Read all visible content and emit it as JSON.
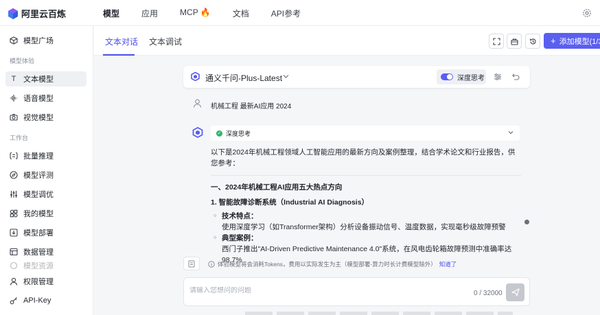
{
  "brand": {
    "name": "阿里云百炼",
    "accent": "#5a5ff0"
  },
  "topnav": {
    "items": [
      "模型",
      "应用",
      "MCP 🔥",
      "文档",
      "API参考"
    ],
    "active": "模型"
  },
  "sidebar": {
    "top": {
      "label": "模型广场",
      "icon": "cube-icon"
    },
    "sections": [
      {
        "title": "模型体验",
        "items": [
          {
            "label": "文本模型",
            "icon": "text-icon",
            "active": true
          },
          {
            "label": "语音模型",
            "icon": "waveform-icon"
          },
          {
            "label": "视觉模型",
            "icon": "camera-icon"
          }
        ]
      },
      {
        "title": "工作台",
        "items": [
          {
            "label": "批量推理",
            "icon": "list-icon"
          },
          {
            "label": "模型评测",
            "icon": "compass-icon"
          },
          {
            "label": "模型调优",
            "icon": "sliders-icon"
          },
          {
            "label": "我的模型",
            "icon": "grid-icon"
          },
          {
            "label": "模型部署",
            "icon": "deploy-icon"
          },
          {
            "label": "数据管理",
            "icon": "database-icon"
          },
          {
            "label": "模型资源",
            "icon": "resource-icon"
          }
        ]
      }
    ],
    "bottom": [
      {
        "label": "权限管理",
        "icon": "user-icon"
      },
      {
        "label": "API-Key",
        "icon": "key-icon"
      }
    ]
  },
  "main": {
    "tabs": [
      "文本对话",
      "文本调试"
    ],
    "active_tab": "文本对话",
    "add_button": "添加模型(1/3)",
    "model": {
      "name": "通义千问-Plus-Latest",
      "deep_think_label": "深度思考",
      "deep_think_on": true
    },
    "conversation": {
      "user_message": "机械工程 最新AI应用 2024",
      "thinking_label": "深度思考",
      "intro": "以下是2024年机械工程领域人工智能应用的最新方向及案例整理，结合学术论文和行业报告，供您参考：",
      "section_title": "一、2024年机械工程AI应用五大热点方向",
      "subsection_title": "1. 智能故障诊断系统（Industrial AI Diagnosis）",
      "bullets": [
        {
          "title": "技术特点：",
          "body": "使用深度学习（如Transformer架构）分析设备振动信号、温度数据，实现毫秒级故障预警"
        },
        {
          "title": "典型案例：",
          "body": "西门子推出\"AI-Driven Predictive Maintenance 4.0\"系统，在风电齿轮箱故障预测中准确率达98.7%"
        }
      ]
    },
    "notice": {
      "text": "体验模型将会消耗Tokens，费用以实际发生为主（模型部署-算力时长计费模型除外）",
      "link": "知道了"
    },
    "input": {
      "placeholder": "请输入您想问的问题",
      "counter": "0 / 32000"
    }
  }
}
